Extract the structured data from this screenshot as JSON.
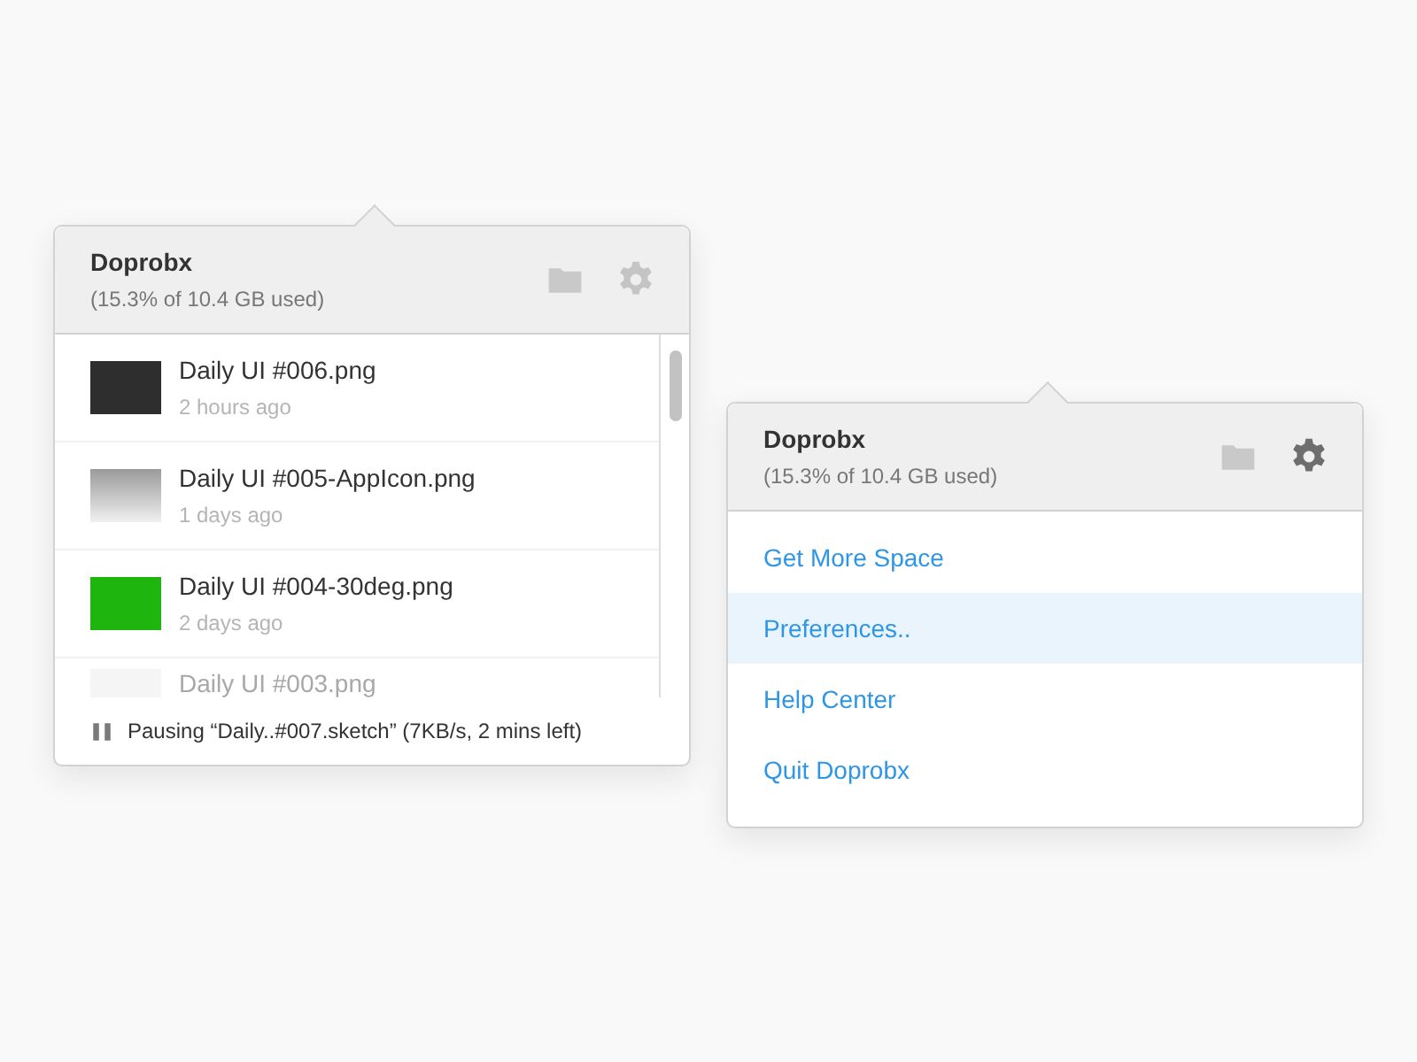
{
  "popovers": [
    {
      "kind": "files",
      "header": {
        "title": "Doprobx",
        "usage": "(15.3% of 10.4 GB used)",
        "settings_active": false
      },
      "files": [
        {
          "name": "Daily UI #006.png",
          "time": "2 hours ago"
        },
        {
          "name": "Daily UI #005-AppIcon.png",
          "time": "1 days ago"
        },
        {
          "name": "Daily UI #004-30deg.png",
          "time": "2 days ago"
        },
        {
          "name": "Daily UI #003.png"
        }
      ],
      "status": "Pausing “Daily..#007.sketch” (7KB/s, 2 mins left)"
    },
    {
      "kind": "menu",
      "header": {
        "title": "Doprobx",
        "usage": "(15.3% of 10.4 GB used)",
        "settings_active": true
      },
      "menu": [
        {
          "label": "Get More Space",
          "selected": false
        },
        {
          "label": "Preferences..",
          "selected": true
        },
        {
          "label": "Help Center",
          "selected": false
        },
        {
          "label": "Quit Doprobx",
          "selected": false
        }
      ]
    }
  ]
}
